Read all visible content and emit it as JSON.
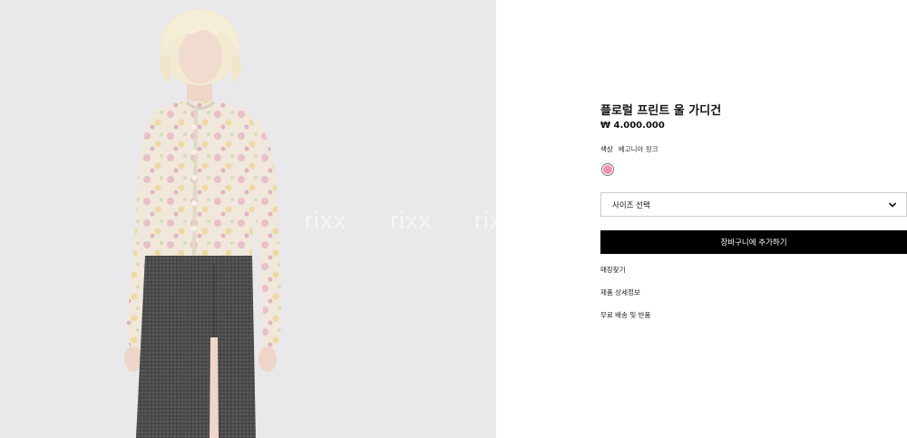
{
  "watermarks": [
    "rixx",
    "rixx",
    "rixx"
  ],
  "product": {
    "title": "플로럴 프린트 울 가디건",
    "price": "₩ 4.000.000",
    "color_label": "색상",
    "color_value": "베고니아 핑크",
    "swatch_color": "#f08fb3",
    "size_select": "사이즈 선택",
    "cart_button": "장바구니에 추가하기"
  },
  "links": [
    {
      "label": "매장찾기"
    },
    {
      "label": "제품 상세정보"
    },
    {
      "label": "무료 배송 및 반품"
    }
  ]
}
